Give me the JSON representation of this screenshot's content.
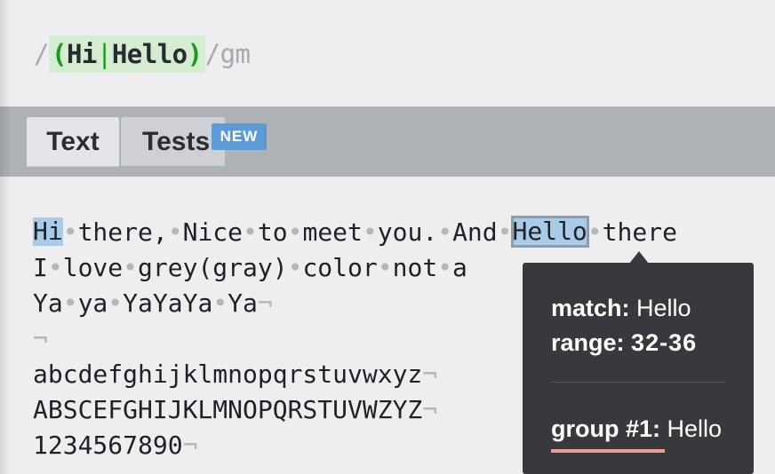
{
  "expression": {
    "open_delim": "/",
    "open_paren": "(",
    "alt1": "Hi",
    "pipe": "|",
    "alt2": "Hello",
    "close_paren": ")",
    "close_delim": "/",
    "flags": "gm"
  },
  "tabs": [
    {
      "label": "Text",
      "active": true
    },
    {
      "label": "Tests",
      "active": false,
      "badge": "NEW"
    }
  ],
  "text_lines": [
    [
      "Hi",
      "there,",
      "Nice",
      "to",
      "meet",
      "you.",
      "And",
      "Hello",
      "there"
    ],
    [
      "I",
      "love",
      "grey(gray)",
      "color",
      "not",
      "a"
    ],
    [
      "Ya",
      "ya",
      "YaYaYa",
      "Ya"
    ],
    [],
    [
      "abcdefghijklmnopqrstuvwxyz"
    ],
    [
      "ABSCEFGHIJKLMNOPQRSTUVWZYZ"
    ],
    [
      "1234567890"
    ]
  ],
  "symbols": {
    "space": "•",
    "newline": "¬"
  },
  "tooltip": {
    "match_label": "match:",
    "match_value": "Hello",
    "range_label": "range:",
    "range_value": "32-36",
    "group_label": "group #1:",
    "group_value": "Hello"
  },
  "colors": {
    "match_highlight": "#a9cbe7",
    "group_highlight": "#d4ecd0",
    "group_paren": "#1a9c1a",
    "tooltip_bg": "#37393d",
    "group_underline": "#f09a95",
    "badge": "#5b9bd8"
  }
}
